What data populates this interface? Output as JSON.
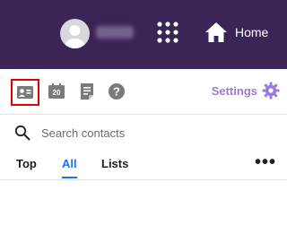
{
  "header": {
    "username": "",
    "home_label": "Home",
    "icons": {
      "avatar": "avatar-icon",
      "apps": "apps-grid-icon",
      "home": "home-icon"
    }
  },
  "toolbar": {
    "calendar_day": "20",
    "settings_label": "Settings",
    "icons": [
      "contacts-card-icon",
      "calendar-icon",
      "notes-icon",
      "help-icon",
      "gear-icon"
    ]
  },
  "search": {
    "placeholder": "Search contacts",
    "value": ""
  },
  "tabs": [
    {
      "label": "Top",
      "active": false
    },
    {
      "label": "All",
      "active": true
    },
    {
      "label": "Lists",
      "active": false
    }
  ],
  "more_label": "•••",
  "colors": {
    "header_bg": "#3b2557",
    "accent": "#9b7bd6",
    "active_tab": "#1a73e8",
    "selected_outline": "#e00000"
  }
}
